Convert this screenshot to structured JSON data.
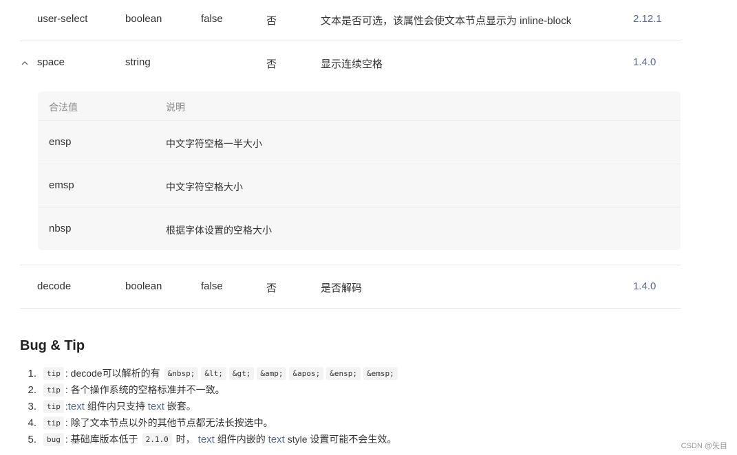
{
  "rows": [
    {
      "name": "user-select",
      "type": "boolean",
      "default": "false",
      "required": "否",
      "desc": "文本是否可选，该属性会使文本节点显示为 inline-block",
      "version": "2.12.1"
    },
    {
      "name": "space",
      "type": "string",
      "default": "",
      "required": "否",
      "desc": "显示连续空格",
      "version": "1.4.0"
    },
    {
      "name": "decode",
      "type": "boolean",
      "default": "false",
      "required": "否",
      "desc": "是否解码",
      "version": "1.4.0"
    }
  ],
  "space_values": {
    "headers": {
      "value": "合法值",
      "desc": "说明"
    },
    "items": [
      {
        "value": "ensp",
        "desc": "中文字符空格一半大小"
      },
      {
        "value": "emsp",
        "desc": "中文字符空格大小"
      },
      {
        "value": "nbsp",
        "desc": "根据字体设置的空格大小"
      }
    ]
  },
  "section_title": "Bug & Tip",
  "tips": [
    {
      "num": "1.",
      "tag": "tip",
      "text1": ": decode可以解析的有",
      "codes": [
        "&nbsp;",
        "&lt;",
        "&gt;",
        "&amp;",
        "&apos;",
        "&ensp;",
        "&emsp;"
      ]
    },
    {
      "num": "2.",
      "tag": "tip",
      "text1": ": 各个操作系统的空格标准并不一致。"
    },
    {
      "num": "3.",
      "tag": "tip",
      "text1": ":",
      "link1": "text",
      "text2": " 组件内只支持 ",
      "link2": "text",
      "text3": " 嵌套。"
    },
    {
      "num": "4.",
      "tag": "tip",
      "text1": ": 除了文本节点以外的其他节点都无法长按选中。"
    },
    {
      "num": "5.",
      "tag": "bug",
      "text1": ": 基础库版本低于",
      "code": "2.1.0",
      "text2": " 时，",
      "link1": "text",
      "text3": " 组件内嵌的 ",
      "link2": "text",
      "text4": " style 设置可能不会生效。"
    }
  ],
  "watermark": "CSDN @矢目",
  "colors": {
    "link": "#576b95",
    "code_bg": "#f3f3f3",
    "subtable_bg": "#f7f7f7"
  }
}
